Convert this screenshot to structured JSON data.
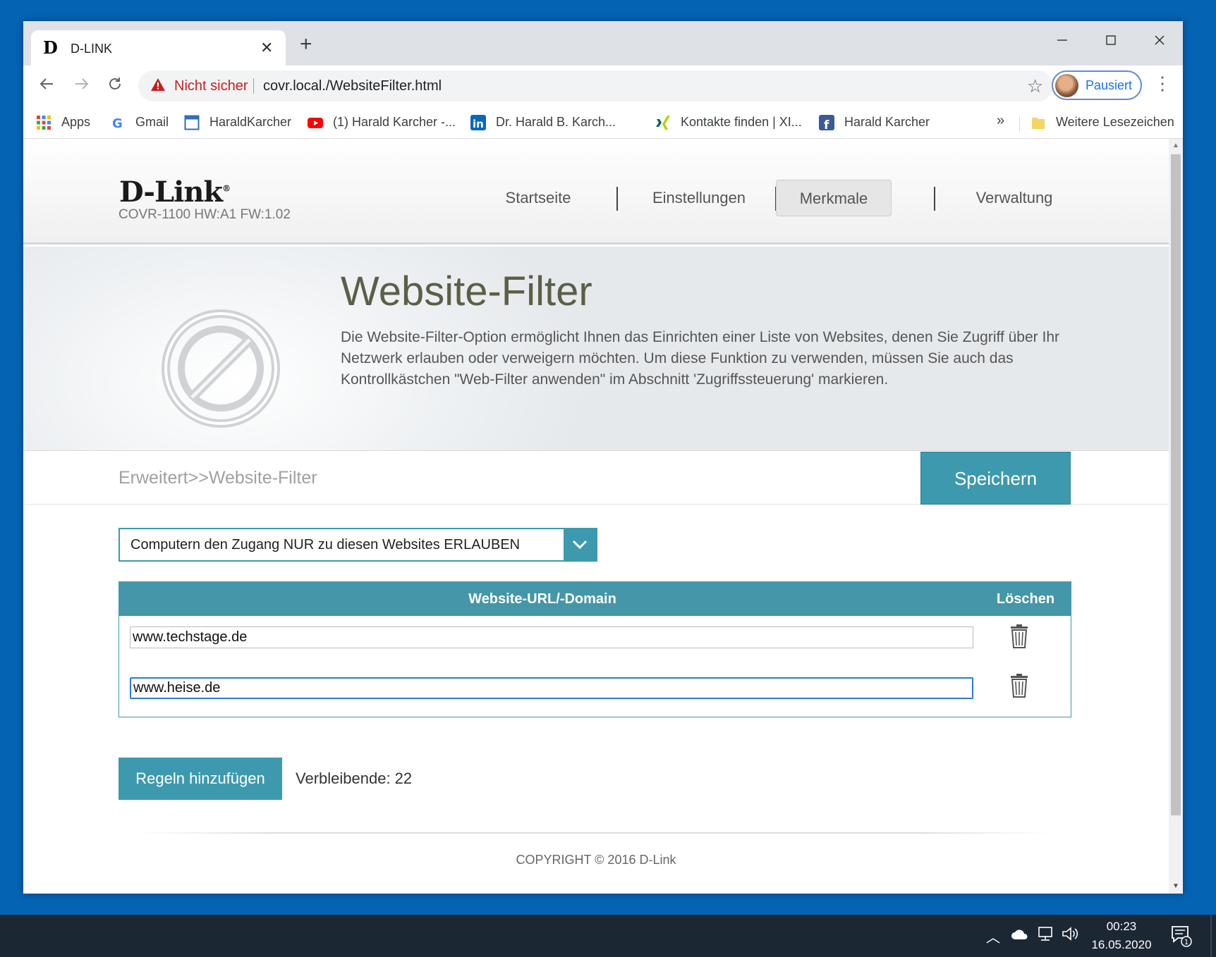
{
  "browser": {
    "tab_title": "D-LINK",
    "tab_favicon": "D",
    "tab_close": "✕",
    "new_tab": "+",
    "security_label": "Nicht sicher",
    "url": "covr.local./WebsiteFilter.html",
    "profile_label": "Pausiert",
    "bookmarks": [
      {
        "label": "Apps",
        "icon": "apps-grid-icon"
      },
      {
        "label": "Gmail",
        "icon": "google-icon"
      },
      {
        "label": "HaraldKarcher",
        "icon": "bookmark-page-icon"
      },
      {
        "label": "(1) Harald Karcher -...",
        "icon": "youtube-icon"
      },
      {
        "label": "Dr. Harald B. Karch...",
        "icon": "linkedin-icon"
      },
      {
        "label": "Kontakte finden | XI...",
        "icon": "xing-icon"
      },
      {
        "label": "Harald Karcher",
        "icon": "facebook-icon"
      }
    ],
    "bookmarks_more": "»",
    "other_bookmarks": "Weitere Lesezeichen"
  },
  "site": {
    "logo": "D-Link",
    "model": "COVR-1100 HW:A1 FW:1.02",
    "nav": [
      "Startseite",
      "Einstellungen",
      "Merkmale",
      "Verwaltung"
    ],
    "active_nav": "Merkmale",
    "hero_title": "Website-Filter",
    "hero_text": "Die Website-Filter-Option ermöglicht Ihnen das Einrichten einer Liste von Websites, denen Sie Zugriff über Ihr Netzwerk erlauben oder verweigern möchten. Um diese Funktion zu verwenden, müssen Sie auch das Kontrollkästchen \"Web-Filter anwenden\" im Abschnitt 'Zugriffssteuerung' markieren.",
    "breadcrumb": "Erweitert>>Website-Filter",
    "save_label": "Speichern",
    "mode_value": "Computern den Zugang NUR zu diesen Websites ERLAUBEN",
    "table": {
      "col_url": "Website-URL/-Domain",
      "col_delete": "Löschen",
      "rows": [
        "www.techstage.de",
        "www.heise.de"
      ]
    },
    "add_rule_label": "Regeln hinzufügen",
    "remaining": "Verbleibende: 22",
    "copyright": "COPYRIGHT © 2016 D-Link"
  },
  "taskbar": {
    "time": "00:23",
    "date": "16.05.2020",
    "notification_count": "1"
  },
  "colors": {
    "accent": "#3d9aae",
    "table_header": "#4596a8",
    "desktop": "#0563b4",
    "taskbar": "#1c2734",
    "warning": "#c5221f"
  }
}
